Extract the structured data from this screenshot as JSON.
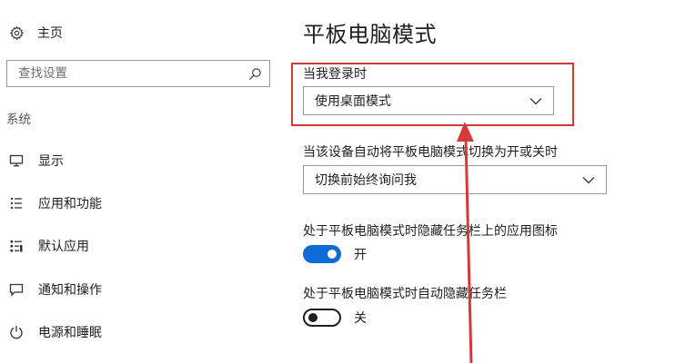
{
  "sidebar": {
    "home_label": "主页",
    "search_placeholder": "查找设置",
    "section_label": "系统",
    "items": [
      {
        "label": "显示",
        "icon": "monitor-icon"
      },
      {
        "label": "应用和功能",
        "icon": "list-icon"
      },
      {
        "label": "默认应用",
        "icon": "default-apps-icon"
      },
      {
        "label": "通知和操作",
        "icon": "notification-icon"
      },
      {
        "label": "电源和睡眠",
        "icon": "power-icon"
      }
    ]
  },
  "main": {
    "title": "平板电脑模式",
    "signin_label": "当我登录时",
    "signin_value": "使用桌面模式",
    "switch_label": "当该设备自动将平板电脑模式切换为开或关时",
    "switch_value": "切换前始终询问我",
    "hide_icons_label": "处于平板电脑模式时隐藏任务栏上的应用图标",
    "hide_icons_state": "开",
    "hide_taskbar_label": "处于平板电脑模式时自动隐藏任务栏",
    "hide_taskbar_state": "关"
  },
  "colors": {
    "accent": "#0f6cd6",
    "annotation": "#d33a3a"
  }
}
